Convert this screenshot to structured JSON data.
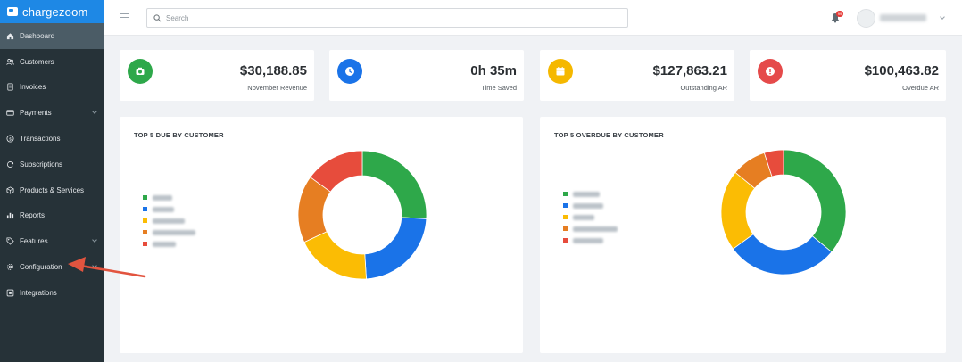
{
  "brand": {
    "name": "chargezoom"
  },
  "sidebar": {
    "items": [
      {
        "label": "Dashboard",
        "icon": "home-icon",
        "active": true,
        "caret": false
      },
      {
        "label": "Customers",
        "icon": "users-icon",
        "active": false,
        "caret": false
      },
      {
        "label": "Invoices",
        "icon": "invoice-icon",
        "active": false,
        "caret": false
      },
      {
        "label": "Payments",
        "icon": "credit-card-icon",
        "active": false,
        "caret": true
      },
      {
        "label": "Transactions",
        "icon": "dollar-circle-icon",
        "active": false,
        "caret": false
      },
      {
        "label": "Subscriptions",
        "icon": "refresh-icon",
        "active": false,
        "caret": false
      },
      {
        "label": "Products & Services",
        "icon": "box-icon",
        "active": false,
        "caret": false
      },
      {
        "label": "Reports",
        "icon": "bar-chart-icon",
        "active": false,
        "caret": false
      },
      {
        "label": "Features",
        "icon": "tag-icon",
        "active": false,
        "caret": true
      },
      {
        "label": "Configuration",
        "icon": "gear-icon",
        "active": false,
        "caret": true
      },
      {
        "label": "Integrations",
        "icon": "puzzle-icon",
        "active": false,
        "caret": false
      }
    ]
  },
  "topbar": {
    "search_placeholder": "Search",
    "notification_count": "99"
  },
  "stats": [
    {
      "value": "$30,188.85",
      "label": "November Revenue",
      "color": "#2ea84a",
      "icon": "camera-icon"
    },
    {
      "value": "0h 35m",
      "label": "Time Saved",
      "color": "#1a73e8",
      "icon": "clock-icon"
    },
    {
      "value": "$127,863.21",
      "label": "Outstanding AR",
      "color": "#f5b800",
      "icon": "calendar-icon"
    },
    {
      "value": "$100,463.82",
      "label": "Overdue AR",
      "color": "#e54a4a",
      "icon": "alert-icon"
    }
  ],
  "chart_data": [
    {
      "type": "pie",
      "title": "TOP 5 DUE BY CUSTOMER",
      "categories": [
        "",
        "",
        "",
        "",
        ""
      ],
      "values": [
        26,
        23,
        19,
        17,
        15
      ],
      "colors": [
        "#2ea84a",
        "#1a73e8",
        "#fbbc04",
        "#e67e22",
        "#e74c3c"
      ]
    },
    {
      "type": "pie",
      "title": "TOP 5 OVERDUE BY CUSTOMER",
      "categories": [
        "",
        "",
        "",
        "",
        ""
      ],
      "values": [
        36,
        29,
        21,
        9,
        5
      ],
      "colors": [
        "#2ea84a",
        "#1a73e8",
        "#fbbc04",
        "#e67e22",
        "#e74c3c"
      ]
    }
  ]
}
